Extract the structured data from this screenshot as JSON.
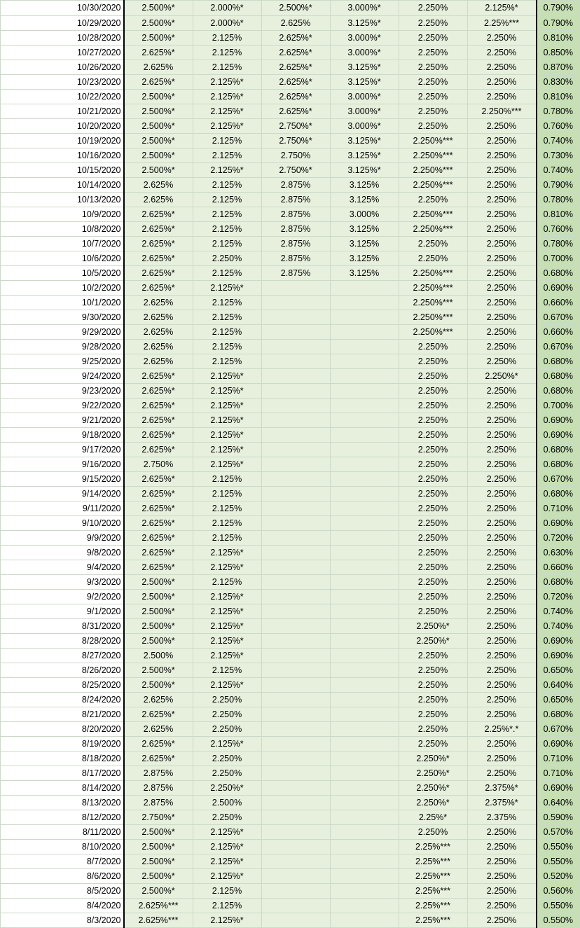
{
  "rows": [
    [
      "10/30/2020",
      "2.500%*",
      "2.000%*",
      "2.500%*",
      "3.000%*",
      "2.250%",
      "2.125%*",
      "0.790%"
    ],
    [
      "10/29/2020",
      "2.500%*",
      "2.000%*",
      "2.625%",
      "3.125%*",
      "2.250%",
      "2.25%***",
      "0.790%"
    ],
    [
      "10/28/2020",
      "2.500%*",
      "2.125%",
      "2.625%*",
      "3.000%*",
      "2.250%",
      "2.250%",
      "0.810%"
    ],
    [
      "10/27/2020",
      "2.625%*",
      "2.125%",
      "2.625%*",
      "3.000%*",
      "2.250%",
      "2.250%",
      "0.850%"
    ],
    [
      "10/26/2020",
      "2.625%",
      "2.125%",
      "2.625%*",
      "3.125%*",
      "2.250%",
      "2.250%",
      "0.870%"
    ],
    [
      "10/23/2020",
      "2.625%*",
      "2.125%*",
      "2.625%*",
      "3.125%*",
      "2.250%",
      "2.250%",
      "0.830%"
    ],
    [
      "10/22/2020",
      "2.500%*",
      "2.125%*",
      "2.625%*",
      "3.000%*",
      "2.250%",
      "2.250%",
      "0.810%"
    ],
    [
      "10/21/2020",
      "2.500%*",
      "2.125%*",
      "2.625%*",
      "3.000%*",
      "2.250%",
      "2.250%***",
      "0.780%"
    ],
    [
      "10/20/2020",
      "2.500%*",
      "2.125%*",
      "2.750%*",
      "3.000%*",
      "2.250%",
      "2.250%",
      "0.760%"
    ],
    [
      "10/19/2020",
      "2.500%*",
      "2.125%",
      "2.750%*",
      "3.125%*",
      "2.250%***",
      "2.250%",
      "0.740%"
    ],
    [
      "10/16/2020",
      "2.500%*",
      "2.125%",
      "2.750%",
      "3.125%*",
      "2.250%***",
      "2.250%",
      "0.730%"
    ],
    [
      "10/15/2020",
      "2.500%*",
      "2.125%*",
      "2.750%*",
      "3.125%*",
      "2.250%***",
      "2.250%",
      "0.740%"
    ],
    [
      "10/14/2020",
      "2.625%",
      "2.125%",
      "2.875%",
      "3.125%",
      "2.250%***",
      "2.250%",
      "0.790%"
    ],
    [
      "10/13/2020",
      "2.625%",
      "2.125%",
      "2.875%",
      "3.125%",
      "2.250%",
      "2.250%",
      "0.780%"
    ],
    [
      "10/9/2020",
      "2.625%*",
      "2.125%",
      "2.875%",
      "3.000%",
      "2.250%***",
      "2.250%",
      "0.810%"
    ],
    [
      "10/8/2020",
      "2.625%*",
      "2.125%",
      "2.875%",
      "3.125%",
      "2.250%***",
      "2.250%",
      "0.760%"
    ],
    [
      "10/7/2020",
      "2.625%*",
      "2.125%",
      "2.875%",
      "3.125%",
      "2.250%",
      "2.250%",
      "0.780%"
    ],
    [
      "10/6/2020",
      "2.625%*",
      "2.250%",
      "2.875%",
      "3.125%",
      "2.250%",
      "2.250%",
      "0.700%"
    ],
    [
      "10/5/2020",
      "2.625%*",
      "2.125%",
      "2.875%",
      "3.125%",
      "2.250%***",
      "2.250%",
      "0.680%"
    ],
    [
      "10/2/2020",
      "2.625%*",
      "2.125%*",
      "",
      "",
      "2.250%***",
      "2.250%",
      "0.690%"
    ],
    [
      "10/1/2020",
      "2.625%",
      "2.125%",
      "",
      "",
      "2.250%***",
      "2.250%",
      "0.660%"
    ],
    [
      "9/30/2020",
      "2.625%",
      "2.125%",
      "",
      "",
      "2.250%***",
      "2.250%",
      "0.670%"
    ],
    [
      "9/29/2020",
      "2.625%",
      "2.125%",
      "",
      "",
      "2.250%***",
      "2.250%",
      "0.660%"
    ],
    [
      "9/28/2020",
      "2.625%",
      "2.125%",
      "",
      "",
      "2.250%",
      "2.250%",
      "0.670%"
    ],
    [
      "9/25/2020",
      "2.625%",
      "2.125%",
      "",
      "",
      "2.250%",
      "2.250%",
      "0.680%"
    ],
    [
      "9/24/2020",
      "2.625%*",
      "2.125%*",
      "",
      "",
      "2.250%",
      "2.250%*",
      "0.680%"
    ],
    [
      "9/23/2020",
      "2.625%*",
      "2.125%*",
      "",
      "",
      "2.250%",
      "2.250%",
      "0.680%"
    ],
    [
      "9/22/2020",
      "2.625%*",
      "2.125%*",
      "",
      "",
      "2.250%",
      "2.250%",
      "0.700%"
    ],
    [
      "9/21/2020",
      "2.625%*",
      "2.125%*",
      "",
      "",
      "2.250%",
      "2.250%",
      "0.690%"
    ],
    [
      "9/18/2020",
      "2.625%*",
      "2.125%*",
      "",
      "",
      "2.250%",
      "2.250%",
      "0.690%"
    ],
    [
      "9/17/2020",
      "2.625%*",
      "2.125%*",
      "",
      "",
      "2.250%",
      "2.250%",
      "0.680%"
    ],
    [
      "9/16/2020",
      "2.750%",
      "2.125%*",
      "",
      "",
      "2.250%",
      "2.250%",
      "0.680%"
    ],
    [
      "9/15/2020",
      "2.625%*",
      "2.125%",
      "",
      "",
      "2.250%",
      "2.250%",
      "0.670%"
    ],
    [
      "9/14/2020",
      "2.625%*",
      "2.125%",
      "",
      "",
      "2.250%",
      "2.250%",
      "0.680%"
    ],
    [
      "9/11/2020",
      "2.625%*",
      "2.125%",
      "",
      "",
      "2.250%",
      "2.250%",
      "0.710%"
    ],
    [
      "9/10/2020",
      "2.625%*",
      "2.125%",
      "",
      "",
      "2.250%",
      "2.250%",
      "0.690%"
    ],
    [
      "9/9/2020",
      "2.625%*",
      "2.125%",
      "",
      "",
      "2.250%",
      "2.250%",
      "0.720%"
    ],
    [
      "9/8/2020",
      "2.625%*",
      "2.125%*",
      "",
      "",
      "2.250%",
      "2.250%",
      "0.630%"
    ],
    [
      "9/4/2020",
      "2.625%*",
      "2.125%*",
      "",
      "",
      "2.250%",
      "2.250%",
      "0.660%"
    ],
    [
      "9/3/2020",
      "2.500%*",
      "2.125%",
      "",
      "",
      "2.250%",
      "2.250%",
      "0.680%"
    ],
    [
      "9/2/2020",
      "2.500%*",
      "2.125%*",
      "",
      "",
      "2.250%",
      "2.250%",
      "0.720%"
    ],
    [
      "9/1/2020",
      "2.500%*",
      "2.125%*",
      "",
      "",
      "2.250%",
      "2.250%",
      "0.740%"
    ],
    [
      "8/31/2020",
      "2.500%*",
      "2.125%*",
      "",
      "",
      "2.250%*",
      "2.250%",
      "0.740%"
    ],
    [
      "8/28/2020",
      "2.500%*",
      "2.125%*",
      "",
      "",
      "2.250%*",
      "2.250%",
      "0.690%"
    ],
    [
      "8/27/2020",
      "2.500%",
      "2.125%*",
      "",
      "",
      "2.250%",
      "2.250%",
      "0.690%"
    ],
    [
      "8/26/2020",
      "2.500%*",
      "2.125%",
      "",
      "",
      "2.250%",
      "2.250%",
      "0.650%"
    ],
    [
      "8/25/2020",
      "2.500%*",
      "2.125%*",
      "",
      "",
      "2.250%",
      "2.250%",
      "0.640%"
    ],
    [
      "8/24/2020",
      "2.625%",
      "2.250%",
      "",
      "",
      "2.250%",
      "2.250%",
      "0.650%"
    ],
    [
      "8/21/2020",
      "2.625%*",
      "2.250%",
      "",
      "",
      "2.250%",
      "2.250%",
      "0.680%"
    ],
    [
      "8/20/2020",
      "2.625%",
      "2.250%",
      "",
      "",
      "2.250%",
      "2.25%*.*",
      "0.670%"
    ],
    [
      "8/19/2020",
      "2.625%*",
      "2.125%*",
      "",
      "",
      "2.250%",
      "2.250%",
      "0.690%"
    ],
    [
      "8/18/2020",
      "2.625%*",
      "2.250%",
      "",
      "",
      "2.250%*",
      "2.250%",
      "0.710%"
    ],
    [
      "8/17/2020",
      "2.875%",
      "2.250%",
      "",
      "",
      "2.250%*",
      "2.250%",
      "0.710%"
    ],
    [
      "8/14/2020",
      "2.875%",
      "2.250%*",
      "",
      "",
      "2.250%*",
      "2.375%*",
      "0.690%"
    ],
    [
      "8/13/2020",
      "2.875%",
      "2.500%",
      "",
      "",
      "2.250%*",
      "2.375%*",
      "0.640%"
    ],
    [
      "8/12/2020",
      "2.750%*",
      "2.250%",
      "",
      "",
      "2.25%*",
      "2.375%",
      "0.590%"
    ],
    [
      "8/11/2020",
      "2.500%*",
      "2.125%*",
      "",
      "",
      "2.250%",
      "2.250%",
      "0.570%"
    ],
    [
      "8/10/2020",
      "2.500%*",
      "2.125%*",
      "",
      "",
      "2.25%***",
      "2.250%",
      "0.550%"
    ],
    [
      "8/7/2020",
      "2.500%*",
      "2.125%*",
      "",
      "",
      "2.25%***",
      "2.250%",
      "0.550%"
    ],
    [
      "8/6/2020",
      "2.500%*",
      "2.125%*",
      "",
      "",
      "2.25%***",
      "2.250%",
      "0.520%"
    ],
    [
      "8/5/2020",
      "2.500%*",
      "2.125%",
      "",
      "",
      "2.25%***",
      "2.250%",
      "0.560%"
    ],
    [
      "8/4/2020",
      "2.625%***",
      "2.125%",
      "",
      "",
      "2.25%***",
      "2.250%",
      "0.550%"
    ],
    [
      "8/3/2020",
      "2.625%***",
      "2.125%*",
      "",
      "",
      "2.25%***",
      "2.250%",
      "0.550%"
    ]
  ]
}
